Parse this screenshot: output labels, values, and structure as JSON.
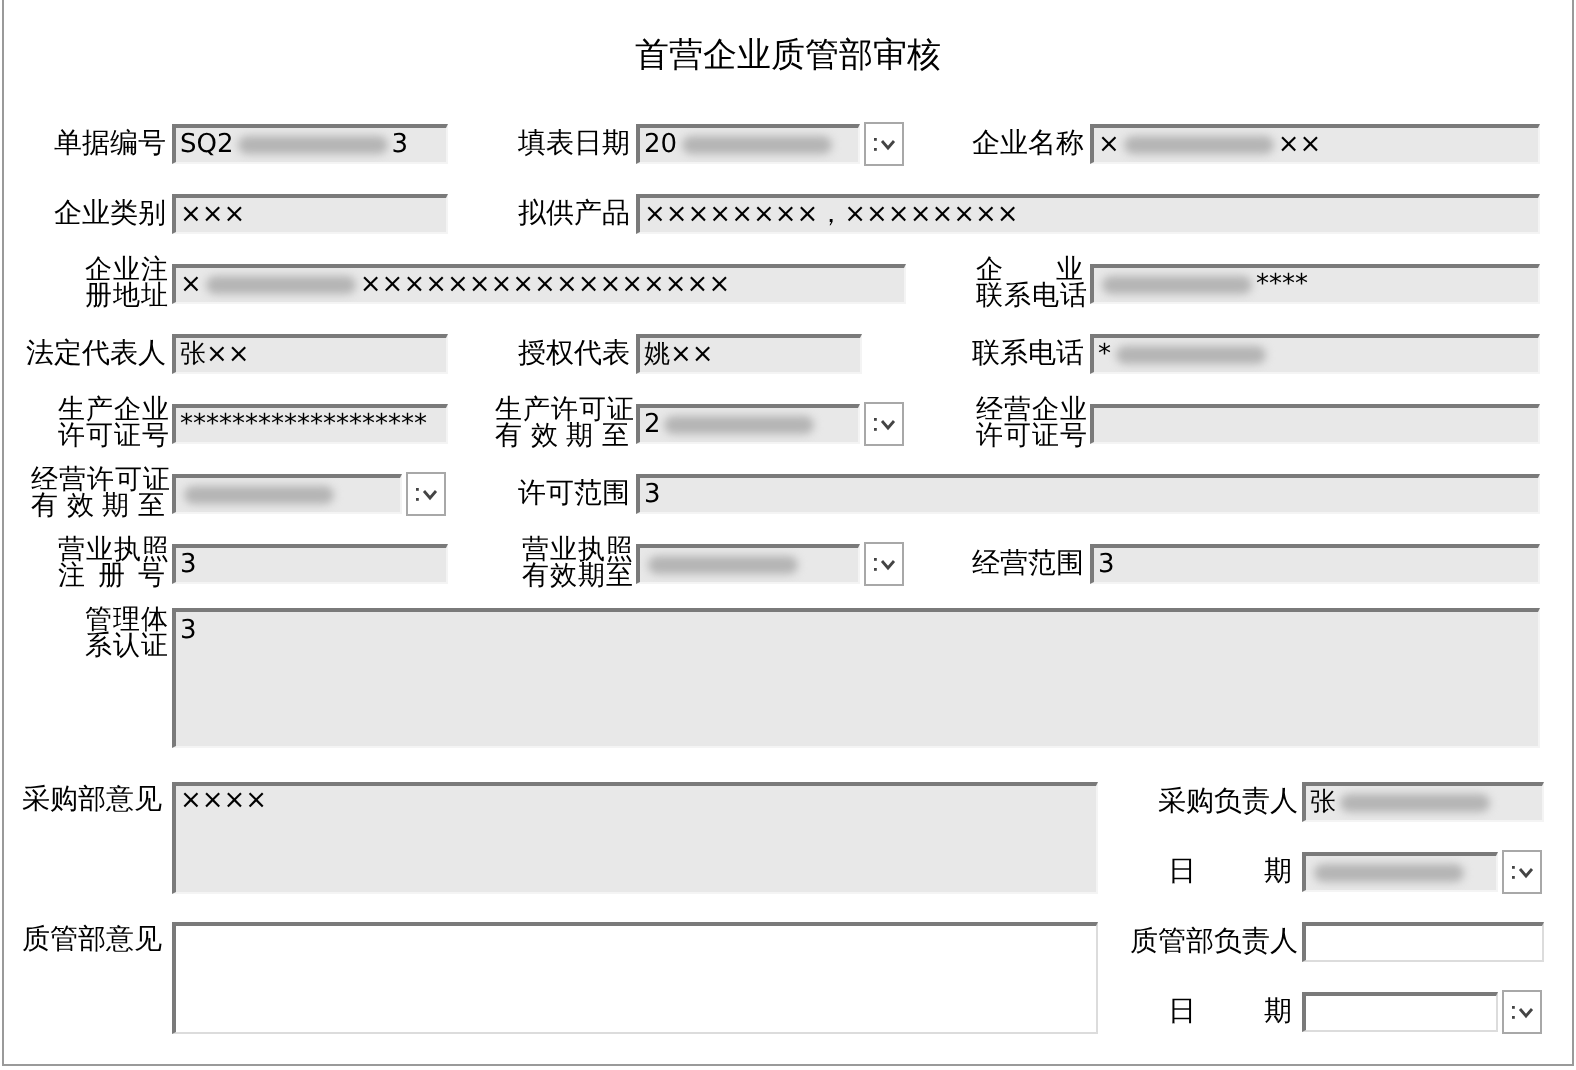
{
  "title": "首营企业质管部审核",
  "rows": [
    [
      {
        "label": [
          "单据编号"
        ],
        "kind": "text",
        "readonly": true,
        "value": "SQ2",
        "redacted": true,
        "suffix": "3"
      },
      {
        "label": [
          "填表日期"
        ],
        "kind": "date",
        "readonly": true,
        "value": "20",
        "redacted": true
      },
      {
        "label": [
          "企业名称"
        ],
        "kind": "text",
        "readonly": true,
        "value": "×",
        "redacted": true,
        "suffix": "××"
      }
    ],
    [
      {
        "label": [
          "企业类别"
        ],
        "kind": "text",
        "readonly": true,
        "value": "×××"
      },
      {
        "label": [
          "拟供产品"
        ],
        "kind": "wide",
        "readonly": true,
        "value": "××××××××，××××××××"
      }
    ],
    [
      {
        "label": [
          "企业注",
          "册地址"
        ],
        "kind": "wide",
        "readonly": true,
        "value": "×",
        "redacted": true,
        "suffix": "×××××××××××××××××"
      },
      {
        "label": [
          "企　业",
          "联系电话"
        ],
        "kind": "text",
        "readonly": true,
        "redacted": true,
        "suffix": "****"
      }
    ],
    [
      {
        "label": [
          "法定代表人"
        ],
        "kind": "text",
        "readonly": true,
        "value": "张××"
      },
      {
        "label": [
          "授权代表"
        ],
        "kind": "text",
        "readonly": true,
        "value": "姚××"
      },
      {
        "label": [
          "联系电话"
        ],
        "kind": "text",
        "readonly": true,
        "value": "*",
        "redacted": true
      }
    ],
    [
      {
        "label": [
          "生产企业",
          "许可证号"
        ],
        "kind": "text",
        "readonly": true,
        "value": "*******************"
      },
      {
        "label": [
          "生产许可证",
          "有效期至"
        ],
        "kind": "date",
        "readonly": true,
        "value": "2",
        "redacted": true
      },
      {
        "label": [
          "经营企业",
          "许可证号"
        ],
        "kind": "text",
        "readonly": true
      }
    ],
    [
      {
        "label": [
          "经营许可证",
          "有效期至"
        ],
        "kind": "date",
        "readonly": true,
        "redacted": true
      },
      {
        "label": [
          "许可范围"
        ],
        "kind": "wide",
        "readonly": true,
        "value": "3"
      }
    ],
    [
      {
        "label": [
          "营业执照",
          "注册号"
        ],
        "kind": "text",
        "readonly": true,
        "value": "3"
      },
      {
        "label": [
          "营业执照",
          "有效期至"
        ],
        "kind": "date",
        "readonly": true,
        "redacted": true
      },
      {
        "label": [
          "经营范围"
        ],
        "kind": "text",
        "readonly": true,
        "value": "3"
      }
    ],
    [
      {
        "label": [
          "管理体",
          "系认证"
        ],
        "kind": "area",
        "readonly": true,
        "value": "3"
      }
    ]
  ],
  "reviews": [
    {
      "label": "采购部意见",
      "readonly": true,
      "value": "××××",
      "person_label": "采购负责人",
      "person": {
        "readonly": true,
        "value": "张",
        "redacted": true
      },
      "date_label": "日期",
      "date": {
        "readonly": true,
        "redacted": true
      }
    },
    {
      "label": "质管部意见",
      "readonly": false,
      "person_label": "质管部负责人",
      "person": {
        "readonly": false
      },
      "date_label": "日期",
      "date": {
        "readonly": false
      }
    }
  ]
}
